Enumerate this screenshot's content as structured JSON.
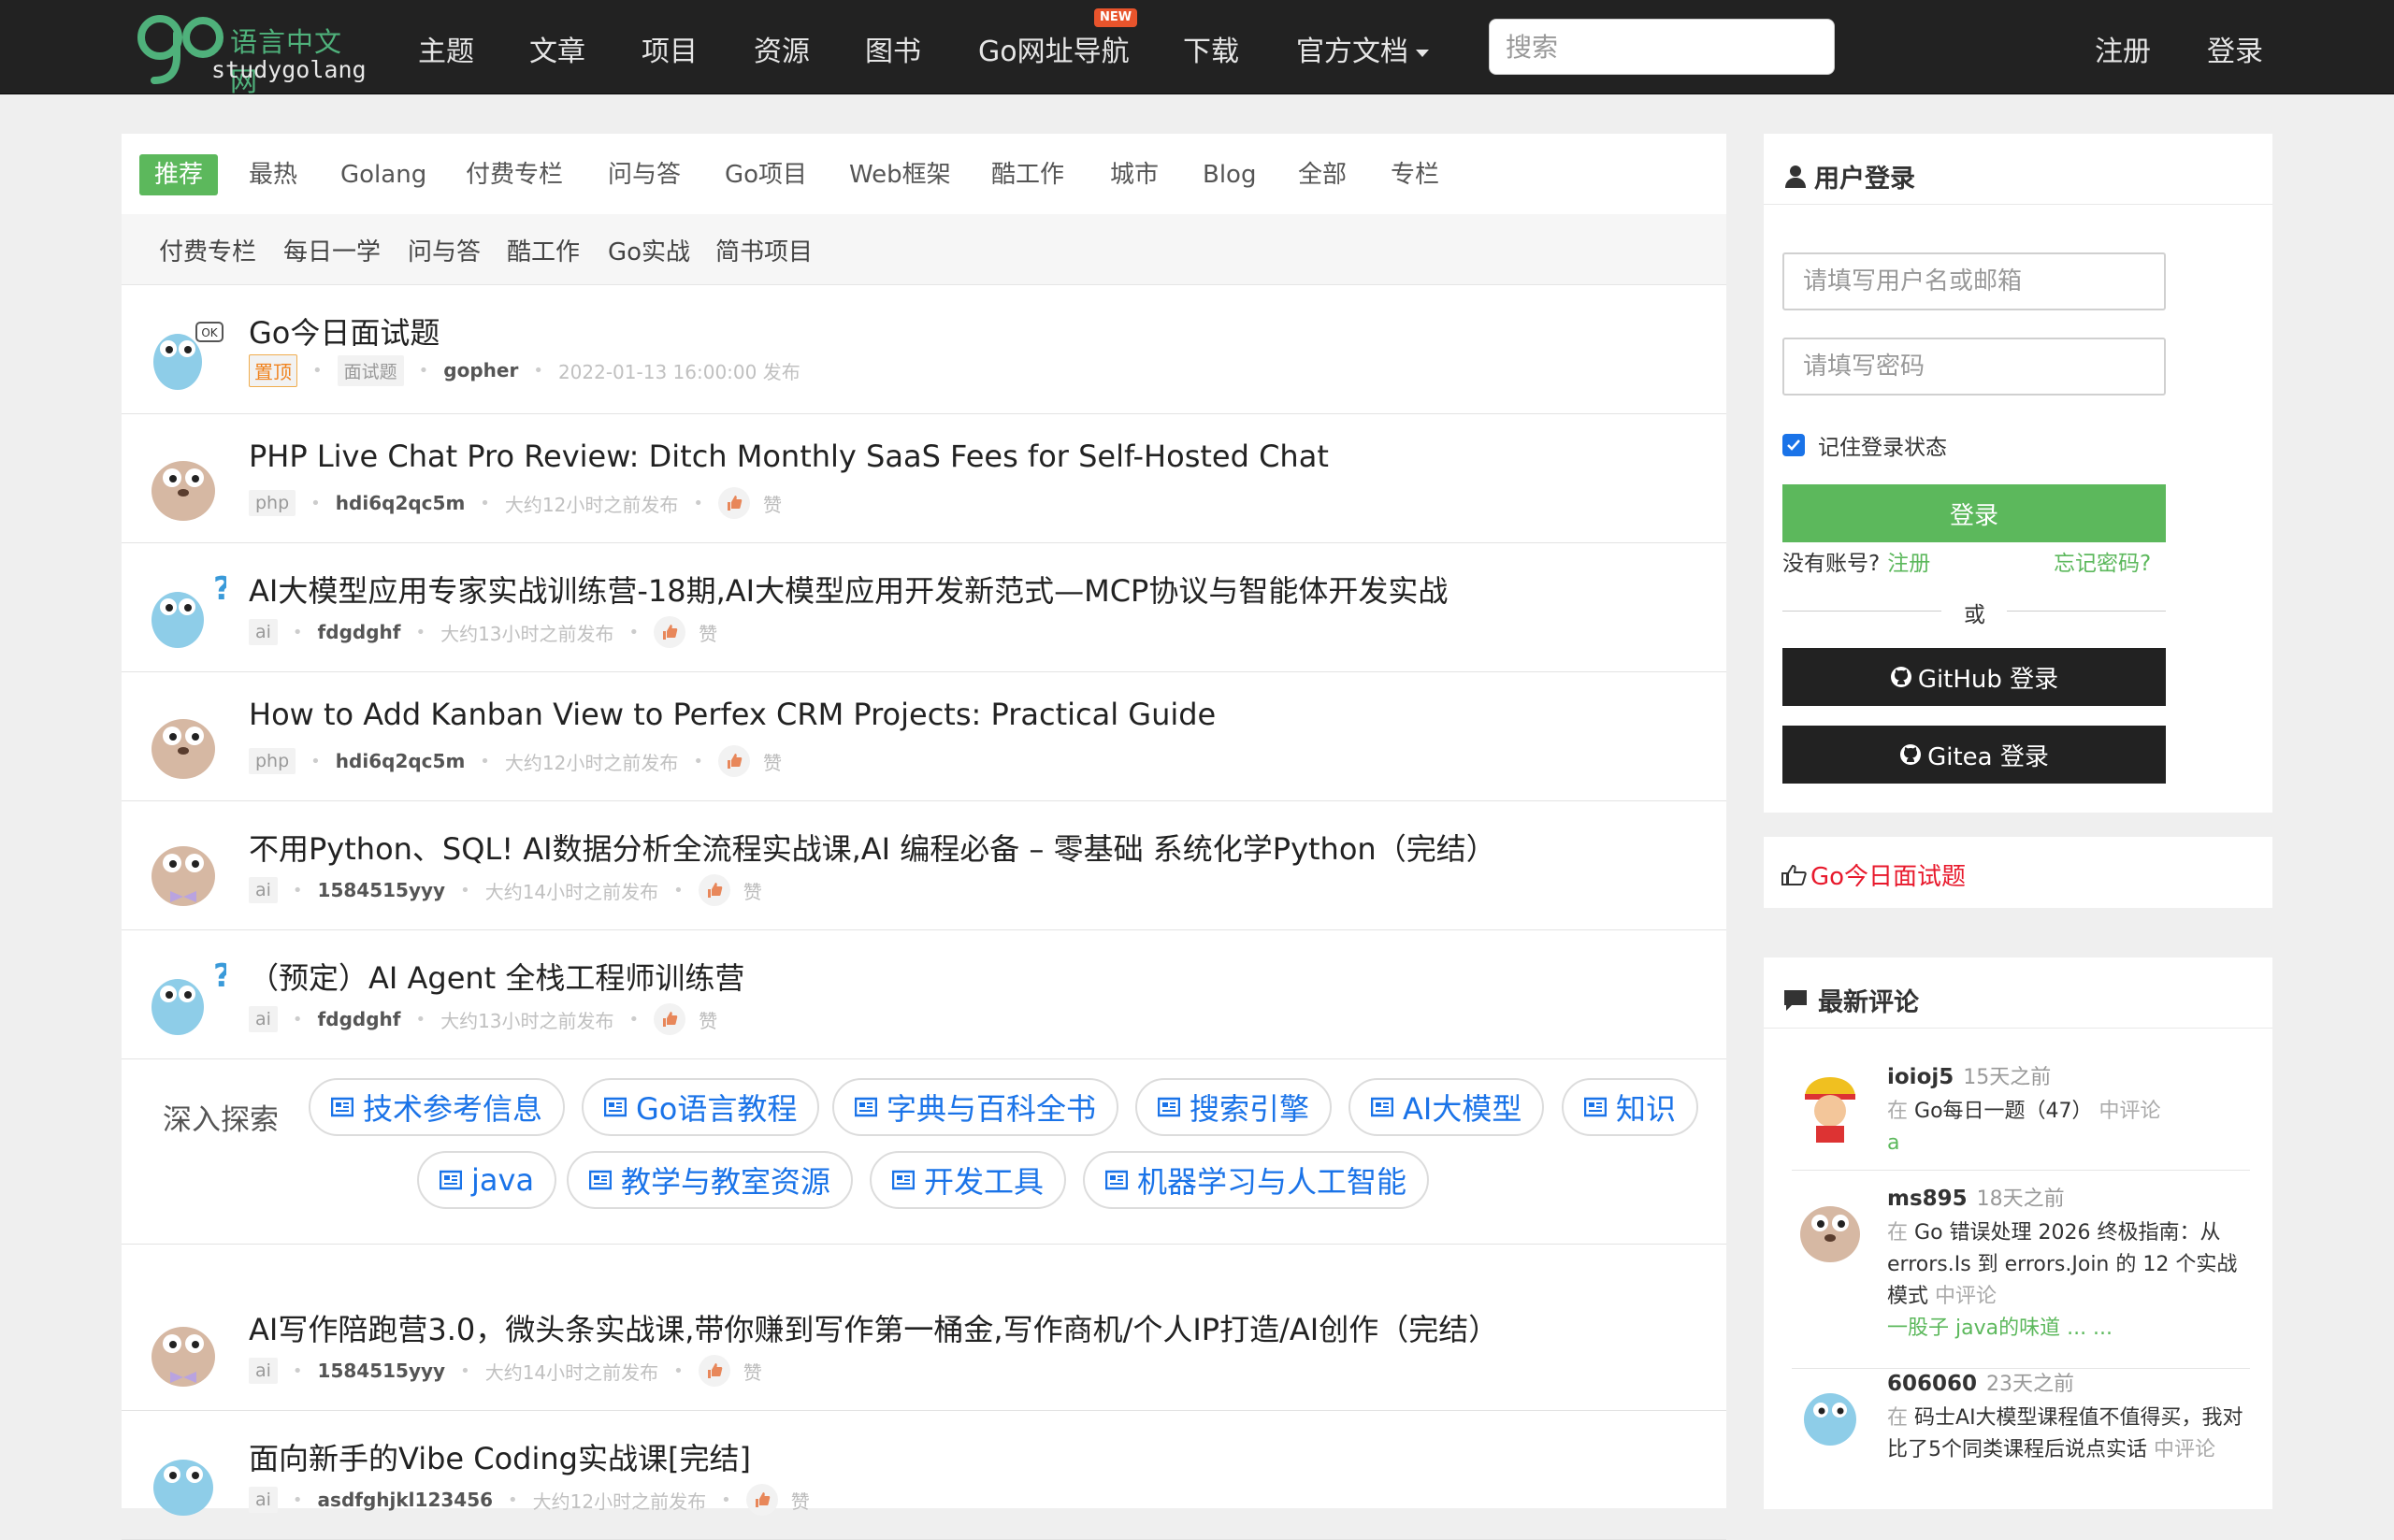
{
  "navbar": {
    "logo_cn": "语言中文网",
    "logo_en": "studygolang",
    "items": [
      "主题",
      "文章",
      "项目",
      "资源",
      "图书",
      "Go网址导航",
      "下载",
      "官方文档"
    ],
    "new_badge": "NEW",
    "search_placeholder": "搜索",
    "register": "注册",
    "login": "登录"
  },
  "tabs_primary": [
    "推荐",
    "最热",
    "Golang",
    "付费专栏",
    "问与答",
    "Go项目",
    "Web框架",
    "酷工作",
    "城市",
    "Blog",
    "全部",
    "专栏"
  ],
  "tabs_secondary": [
    "付费专栏",
    "每日一学",
    "问与答",
    "酷工作",
    "Go实战",
    "简书项目"
  ],
  "topics": [
    {
      "title": "Go今日面试题",
      "pin": "置顶",
      "tag": "面试题",
      "author": "gopher",
      "time": "2022-01-13 16:00:00 发布"
    },
    {
      "title": "PHP Live Chat Pro Review: Ditch Monthly SaaS Fees for Self-Hosted Chat",
      "tag": "php",
      "author": "hdi6q2qc5m",
      "time": "大约12小时之前发布",
      "like": "赞"
    },
    {
      "title": "AI大模型应用专家实战训练营-18期,AI大模型应用开发新范式—MCP协议与智能体开发实战",
      "tag": "ai",
      "author": "fdgdghf",
      "time": "大约13小时之前发布",
      "like": "赞"
    },
    {
      "title": "How to Add Kanban View to Perfex CRM Projects: Practical Guide",
      "tag": "php",
      "author": "hdi6q2qc5m",
      "time": "大约12小时之前发布",
      "like": "赞"
    },
    {
      "title": "不用Python、SQL! AI数据分析全流程实战课,AI 编程必备 – 零基础 系统化学Python（完结）",
      "tag": "ai",
      "author": "1584515yyy",
      "time": "大约14小时之前发布",
      "like": "赞"
    },
    {
      "title": "（预定）AI Agent 全栈工程师训练营",
      "tag": "ai",
      "author": "fdgdghf",
      "time": "大约13小时之前发布",
      "like": "赞"
    },
    {
      "title": "AI写作陪跑营3.0，微头条实战课,带你赚到写作第一桶金,写作商机/个人IP打造/AI创作（完结）",
      "tag": "ai",
      "author": "1584515yyy",
      "time": "大约14小时之前发布",
      "like": "赞"
    },
    {
      "title": "面向新手的Vibe Coding实战课[完结]",
      "tag": "ai",
      "author": "asdfghjkl123456",
      "time": "大约12小时之前发布",
      "like": "赞"
    }
  ],
  "explore": {
    "label": "深入探索",
    "pills": [
      "技术参考信息",
      "Go语言教程",
      "字典与百科全书",
      "搜索引擎",
      "AI大模型",
      "知识",
      "java",
      "教学与教室资源",
      "开发工具",
      "机器学习与人工智能"
    ]
  },
  "login_box": {
    "title": "用户登录",
    "username_placeholder": "请填写用户名或邮箱",
    "password_placeholder": "请填写密码",
    "remember": "记住登录状态",
    "login_button": "登录",
    "no_account": "没有账号?",
    "register": "注册",
    "forgot": "忘记密码?",
    "or": "或",
    "github": "GitHub 登录",
    "gitea": "Gitea 登录"
  },
  "promo_link": "Go今日面试题",
  "comments_box": {
    "title": "最新评论",
    "items": [
      {
        "user": "ioioj5",
        "ago": "15天之前",
        "prefix": "在",
        "topic": "Go每日一题（47）",
        "suffix": "中评论",
        "content": "a"
      },
      {
        "user": "ms895",
        "ago": "18天之前",
        "prefix": "在",
        "topic": "Go 错误处理 2026 终极指南：从 errors.Is 到 errors.Join 的 12 个实战模式",
        "suffix": "中评论",
        "content": "一股子 java的味道 ... ..."
      },
      {
        "user": "606060",
        "ago": "23天之前",
        "prefix": "在",
        "topic": "码士AI大模型课程值不值得买，我对比了5个同类课程后说点实话",
        "suffix": "中评论",
        "content": ""
      }
    ]
  },
  "colors": {
    "green": "#5cb85c",
    "nav_bg": "#222222",
    "link_blue": "#1a73e8",
    "promo_red": "#e8192c"
  }
}
